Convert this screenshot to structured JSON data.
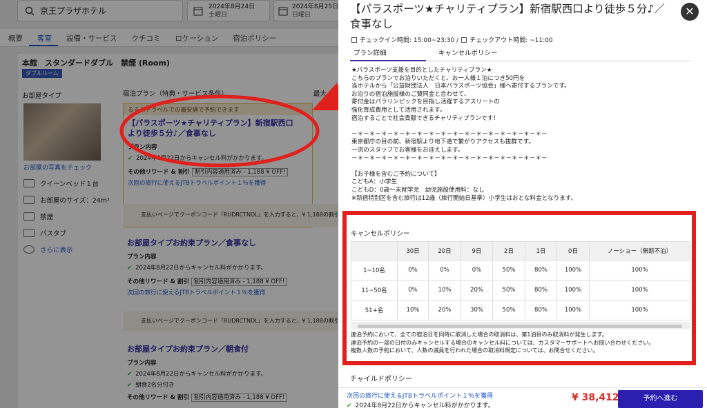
{
  "search": {
    "hotel": "京王プラザホテル",
    "checkin_date": "2024年8月24日",
    "checkin_day": "土曜日",
    "checkout_date": "2024年8月25日",
    "checkout_day": "日曜日"
  },
  "tabs": [
    "概要",
    "客室",
    "設備・サービス",
    "クチコミ",
    "ロケーション",
    "宿泊ポリシー"
  ],
  "room": {
    "title": "本館　スタンダードダブル　禁煙 (Room)",
    "badge": "ダブルルーム",
    "type_heading": "お部屋タイプ",
    "plan_heading": "宿泊プラン（特典・サービス条件）",
    "max_heading": "最大",
    "photo_link": "お部屋の写真をチェック",
    "bed": "クイーンベッド１台",
    "size": "お部屋のサイズ：24m²",
    "smoke": "禁煙",
    "bath": "バスタブ",
    "more": "さらに表示"
  },
  "plans": [
    {
      "banner": "るるぶトラベルでの最安値で予約できます",
      "name": "【パラスポーツ★チャリティプラン】新宿駅西口より徒歩５分♪／食事なし",
      "content_label": "プラン内容",
      "cancel": "2024年8月22日からキャンセル料がかかります。",
      "reward_label": "その他リワード & 割引",
      "reward_badge": "割引内容適用済み - 1,188 ¥ OFF!",
      "points": "次回の旅行に使えるJTBトラベルポイント１％を獲得",
      "coupon": "支払いページでクーポンコード「RUDRCTNDL」を入力すると、¥ 1,188の割引"
    },
    {
      "name": "お部屋タイプお約束プラン／食事なし",
      "content_label": "プラン内容",
      "cancel": "2024年8月22日からキャンセル料がかかります。",
      "reward_label": "その他リワード & 割引",
      "reward_badge": "割引内容適用済み - 1,188 ¥ OFF!",
      "points": "次回の旅行に使えるJTBトラベルポイント１％を獲得",
      "coupon": "支払いページでクーポンコード「RUDRCTNDL」を入力すると、¥ 1,188の割引"
    },
    {
      "name": "お部屋タイプお約束プラン／朝食付",
      "content_label": "プラン内容",
      "cancel": "2024年8月22日からキャンセル料がかかります。",
      "meal": "朝食2名分付き",
      "reward_label": "その他リワード & 割引",
      "reward_badge": "割引内容適用済み - 1,188 ¥ OFF!"
    }
  ],
  "panel": {
    "title": "【パラスポーツ★チャリティプラン】新宿駅西口より徒歩５分♪／食事なし",
    "checkin": "チェックイン時間: 15:00~23:30 /",
    "checkout": "チェックアウト時間: ~11:00",
    "tab_detail": "プラン詳細",
    "tab_cancel": "キャンセルポリシー",
    "description": "★パラスポーツ支援を目的としたチャリティプラン★\nこちらのプランでお泊りいただくと、お一人様１泊につき50円を\n当ホテルから「公益財団法人　日本パラスポーツ協会」様へ寄付するプランです。\nお泊りの宿泊施設様のご賛同金と合わせて、\n寄付金はパラリンピックを目指し活躍するアスリートの\n強化育成費用として活用されます。\n宿泊することで社会貢献できるチャリティプランです！\n\n－＊－＊－＊－＊－＊－＊－＊－＊－＊－＊－＊－＊－＊－＊－＊－＊－\n東京都庁の目の前、新宿駅より地下道で繋がりアクセスも抜群です。\n一流のスタッフでお客様をお迎えします。\n－＊－＊－＊－＊－＊－＊－＊－＊－＊－＊－＊－＊－＊－＊－＊－＊－\n\n【お子様を含むご予約について】\nこどもA：小学生\nこどもD：0歳～未就学児　幼児施設使用料：なし\n※新宿特別区を含む旅行は12歳（旅行開始日基準）小学生はおとな料金となります。",
    "cancel_heading": "キャンセルポリシー",
    "cancel_table": {
      "headers": [
        "",
        "30日",
        "20日",
        "9日",
        "2日",
        "1日",
        "0日",
        "ノーショー（無断不泊）"
      ],
      "rows": [
        [
          "1~10名",
          "0%",
          "0%",
          "0%",
          "50%",
          "80%",
          "100%",
          "100%"
        ],
        [
          "11~50名",
          "0%",
          "10%",
          "20%",
          "50%",
          "80%",
          "100%",
          "100%"
        ],
        [
          "51+名",
          "10%",
          "20%",
          "30%",
          "50%",
          "80%",
          "100%",
          "100%"
        ]
      ]
    },
    "notes": "連泊予約において、全ての宿泊日を同時に取消した場合の取消料は、第1泊目のみ取消料が発生します。\n連泊予約の一部の日付のみキャンセルする場合のキャンセル料については、カスタマーサポートへお問い合わせください。\n複数人数の予約において、人数の減員を行われた場合の取消料規定については、お問合せください。",
    "child_heading": "チャイルドポリシー",
    "footer_points": "次回の旅行に使えるJTBトラベルポイント１％を獲得",
    "footer_cancel": "2024年8月22日からキャンセル料がかかります。",
    "price": "¥ 38,412",
    "reserve": "予約へ進む"
  }
}
